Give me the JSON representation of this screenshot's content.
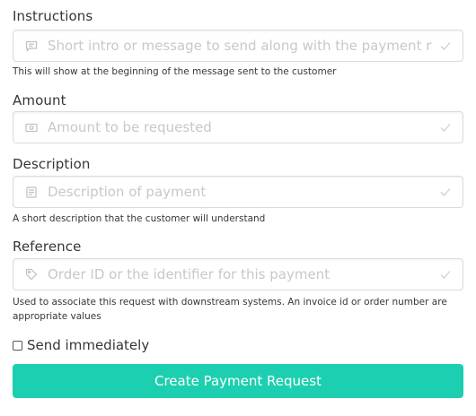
{
  "form": {
    "instructions": {
      "label": "Instructions",
      "placeholder": "Short intro or message to send along with the payment request.",
      "help": "This will show at the beginning of the message sent to the customer",
      "icon": "message-icon"
    },
    "amount": {
      "label": "Amount",
      "placeholder": "Amount to be requested",
      "icon": "money-icon"
    },
    "description": {
      "label": "Description",
      "placeholder": "Description of payment",
      "help": "A short description that the customer will understand",
      "icon": "document-icon"
    },
    "reference": {
      "label": "Reference",
      "placeholder": "Order ID or the identifier for this payment",
      "help_line1": "Used to associate this request with downstream systems. An invoice id or order number are",
      "help_line2": "appropriate values",
      "icon": "tag-icon"
    },
    "send_immediately": {
      "label": "Send immediately",
      "checked": false
    },
    "submit_label": "Create Payment Request"
  },
  "colors": {
    "primary": "#1ccfb0",
    "placeholder": "#c8c8c8",
    "icon": "#c0c0c0",
    "border": "#dbdbdb",
    "text": "#363636"
  }
}
